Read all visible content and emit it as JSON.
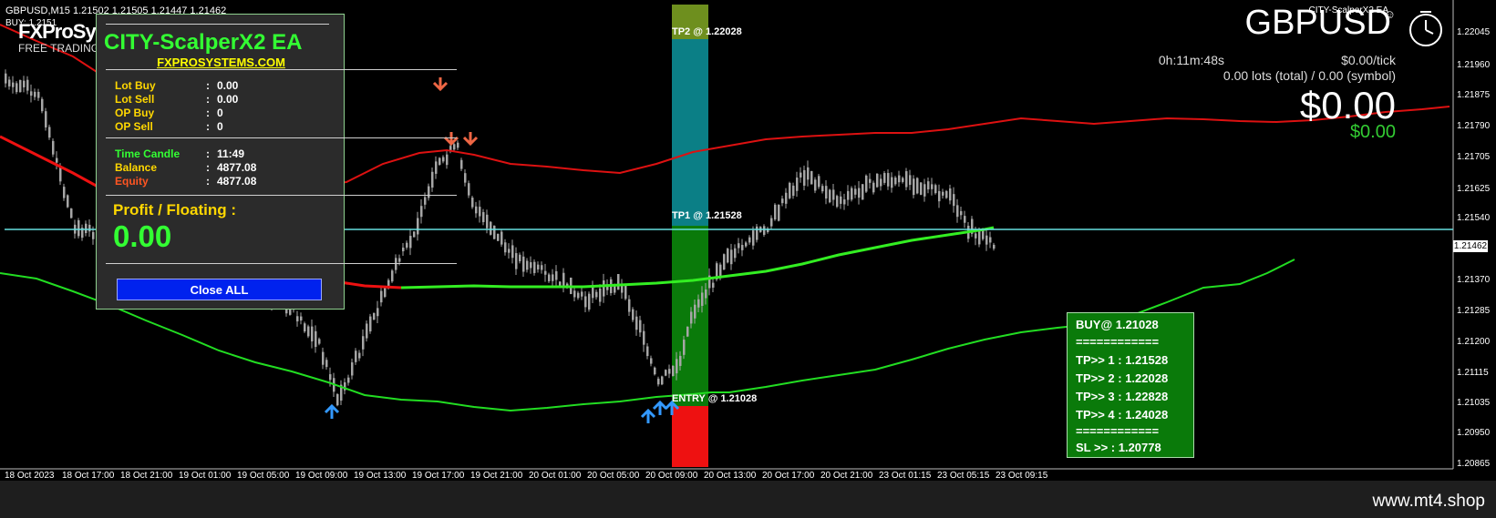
{
  "chart_header": {
    "symbol_info": "GBPUSD,M15  1.21502 1.21505 1.21447 1.21462",
    "ea_short": "BUY: 1.2151",
    "top_right_tag": "CITY-ScalperX2 EA"
  },
  "watermark": {
    "brand": "FXProSyst",
    "subtitle": "FREE TRADING"
  },
  "panel": {
    "title": "CITY-ScalperX2 EA",
    "website": "FXPROSYSTEMS.COM",
    "rows_a": [
      {
        "label": "Lot Buy",
        "value": "0.00"
      },
      {
        "label": "Lot Sell",
        "value": "0.00"
      },
      {
        "label": "OP Buy",
        "value": "0"
      },
      {
        "label": "OP Sell",
        "value": "0"
      }
    ],
    "rows_b": [
      {
        "label": "Time Candle",
        "value": "11:49",
        "color": "#33ff33"
      },
      {
        "label": "Balance",
        "value": "4877.08",
        "color": "#ffd700"
      },
      {
        "label": "Equity",
        "value": "4877.08",
        "color": "#ff5522"
      }
    ],
    "colon": ":",
    "profit_label": "Profit / Floating  :",
    "profit_value": "0.00",
    "close_all_label": "Close ALL"
  },
  "info_right": {
    "symbol": "GBPUSD",
    "timer": "0h:11m:48s",
    "per_tick": "$0.00/tick",
    "lots": "0.00 lots (total) / 0.00 (symbol)",
    "profit_big": "$0.00",
    "profit_small": "$0.00"
  },
  "zones": {
    "tp2_label": "TP2 @ 1.22028",
    "tp1_label": "TP1 @ 1.21528",
    "entry_label": "ENTRY @ 1.21028"
  },
  "buy_box": {
    "rows": [
      "BUY@ 1.21028",
      "============",
      "TP>> 1 : 1.21528",
      "TP>> 2 : 1.22028",
      "TP>> 3 : 1.22828",
      "TP>> 4 : 1.24028",
      "============",
      "SL >> : 1.20778"
    ]
  },
  "price_axis": {
    "labels": [
      "1.22045",
      "1.21960",
      "1.21875",
      "1.21790",
      "1.21705",
      "1.21625",
      "1.21540",
      "1.21370",
      "1.21285",
      "1.21200",
      "1.21115",
      "1.21035",
      "1.20950",
      "1.20865"
    ],
    "current": "1.21462"
  },
  "time_axis": {
    "labels": [
      "18 Oct 2023",
      "18 Oct 17:00",
      "18 Oct 21:00",
      "19 Oct 01:00",
      "19 Oct 05:00",
      "19 Oct 09:00",
      "19 Oct 13:00",
      "19 Oct 17:00",
      "19 Oct 21:00",
      "20 Oct 01:00",
      "20 Oct 05:00",
      "20 Oct 09:00",
      "20 Oct 13:00",
      "20 Oct 17:00",
      "20 Oct 21:00",
      "23 Oct 01:15",
      "23 Oct 05:15",
      "23 Oct 09:15"
    ]
  },
  "footer": {
    "site": "www.mt4.shop"
  },
  "colors": {
    "background": "#000000",
    "candle": "#a6a6a6",
    "upper_band": "#dd1111",
    "lower_band": "#22dd22",
    "mid_red": "#ee1111",
    "mid_green": "#33ee22",
    "tp1_line": "#66e0e0",
    "zone_tp2": "#6e8f1e",
    "zone_tp2_body": "#0b7f86",
    "zone_tp1": "#0a7a0a",
    "zone_sl": "#ee1111",
    "arrow_down": "#ee6644",
    "arrow_up": "#3399ff"
  }
}
